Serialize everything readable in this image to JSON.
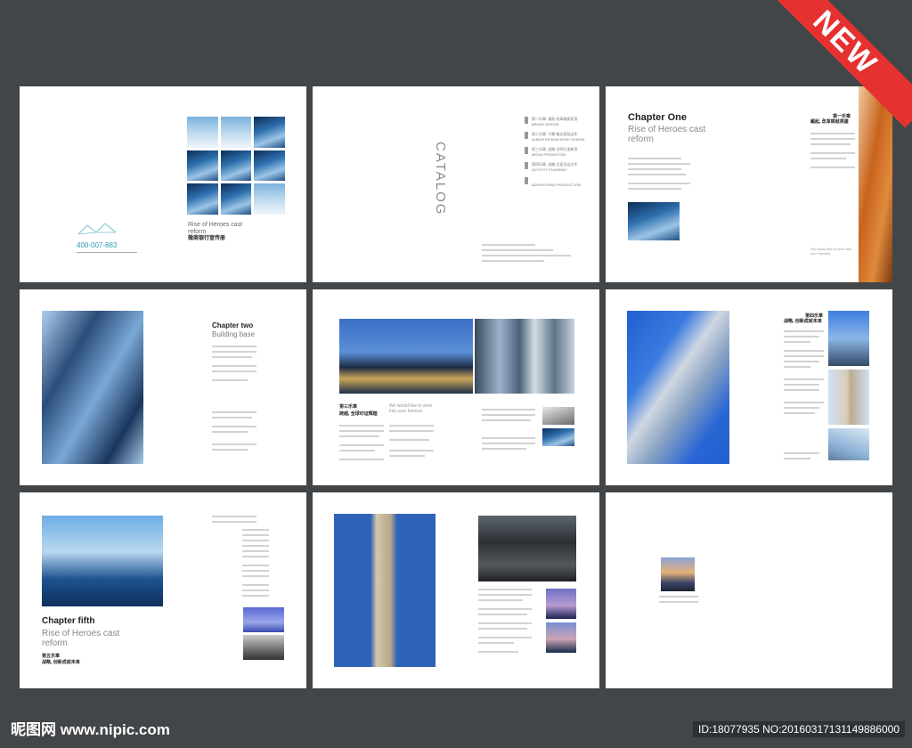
{
  "badge": "NEW",
  "page1": {
    "phone": "400-007-883",
    "subtitle": "Rise of Heroes cast reform",
    "title_cn": "微商银行宣传册"
  },
  "page2": {
    "catalog": "CATALOG",
    "items": [
      {
        "cn": "第一乐章, 通航 改革确保奖项",
        "en": "BRAND DESIGN"
      },
      {
        "cn": "第二乐章, 引擎 概念奖励运作",
        "en": "ALBUM DESIGN BOOK DESIGN"
      },
      {
        "cn": "第三乐章, 战略 全明打造新项",
        "en": "MEDIA PROMOTION"
      },
      {
        "cn": "第四乐章, 战略 后驱活动大作",
        "en": "ACTIVITY PLANNING"
      },
      {
        "cn": "",
        "en": "ADVERTISING PRODUCTION"
      }
    ]
  },
  "page3": {
    "title": "Chapter One",
    "subtitle": "Rise of Heroes cast reform",
    "side_cn1": "第一乐章",
    "side_cn2": "崛起, 改革铸就英雄",
    "side_en": "We would like to work into your harvest"
  },
  "page4": {
    "title": "Chapter two",
    "subtitle": "Building base"
  },
  "page5": {
    "cn1": "第三乐章",
    "cn2": "跨越, 全球印证辉煌",
    "en": "We would like to work into your harvest"
  },
  "page6": {
    "cn1": "第四乐章",
    "cn2": "战略, 创新成就未来"
  },
  "page7": {
    "title": "Chapter fifth",
    "subtitle": "Rise of Heroes cast reform",
    "cn1": "第五乐章",
    "cn2": "战略, 创新成就未来"
  },
  "footer": {
    "logo": "昵图网 www.nipic.com",
    "id": "ID:18077935 NO:20160317131149886000"
  }
}
